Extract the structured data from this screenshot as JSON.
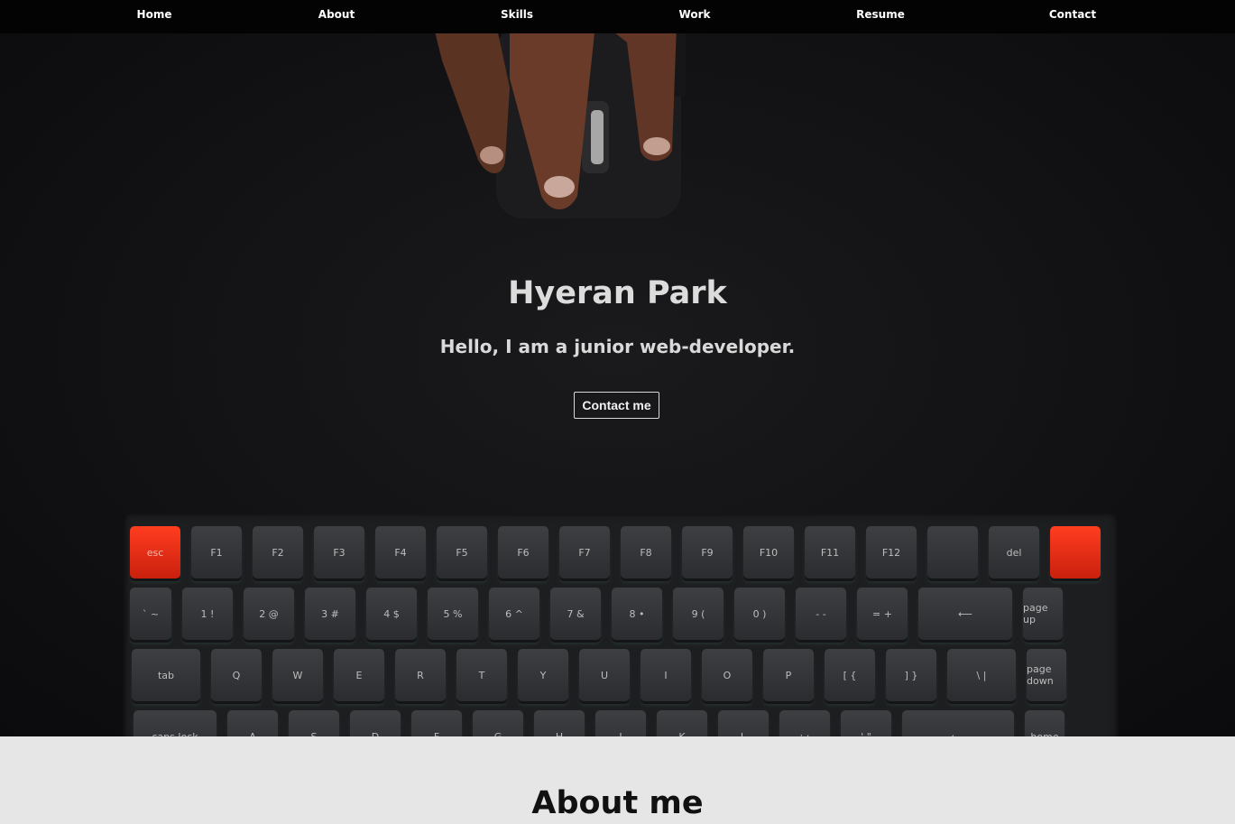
{
  "nav": {
    "items": [
      {
        "label": "Home"
      },
      {
        "label": "About"
      },
      {
        "label": "Skills"
      },
      {
        "label": "Work"
      },
      {
        "label": "Resume"
      },
      {
        "label": "Contact"
      }
    ]
  },
  "hero": {
    "title": "Hyeran Park",
    "subtitle": "Hello, I am a junior web-developer.",
    "button_label": "Contact me"
  },
  "keyboard_keys": {
    "row1": [
      "esc",
      "F1",
      "F2",
      "F3",
      "F4",
      "F5",
      "F6",
      "F7",
      "F8",
      "F9",
      "F10",
      "F11",
      "F12",
      "",
      "del",
      ""
    ],
    "row2": [
      "` ~",
      "1 !",
      "2 @",
      "3 #",
      "4 $",
      "5 %",
      "6 ^",
      "7 &",
      "8 •",
      "9 (",
      "0 )",
      "- -",
      "= +",
      "⟵",
      "page up"
    ],
    "row3": [
      "tab",
      "Q",
      "W",
      "E",
      "R",
      "T",
      "Y",
      "U",
      "I",
      "O",
      "P",
      "[ {",
      "] }",
      "\\ |",
      "page down"
    ],
    "row4": [
      "caps lock",
      "A",
      "S",
      "D",
      "F",
      "G",
      "H",
      "J",
      "K",
      "L",
      "; :",
      "' \"",
      "⟵",
      "home"
    ]
  },
  "about": {
    "title": "About me"
  },
  "colors": {
    "nav_bg": "#030303",
    "hero_bg": "#121214",
    "accent_key": "#e32a12",
    "about_bg": "#e6e6e6"
  }
}
